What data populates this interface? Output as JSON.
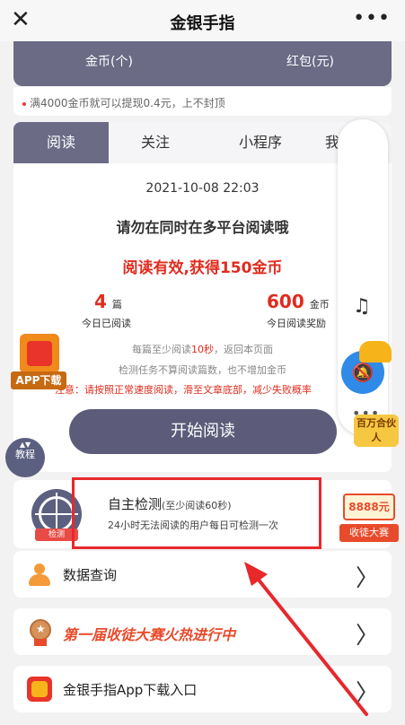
{
  "header": {
    "title": "金银手指",
    "close_glyph": "✕",
    "more_glyph": "•••"
  },
  "stats": {
    "gold_label": "金币(个)",
    "redpacket_label": "红包(元)"
  },
  "notice": "满4000金币就可以提现0.4元，上不封顶",
  "tabs": [
    {
      "label": "阅读",
      "active": true
    },
    {
      "label": "关注",
      "active": false
    },
    {
      "label": "小程序",
      "active": false
    },
    {
      "label": "我",
      "active": false
    }
  ],
  "reading": {
    "datetime": "2021-10-08 22:03",
    "warning": "请勿在同时在多平台阅读哦",
    "reward": "阅读有效,获得150金币",
    "read_count": "4",
    "read_unit": "篇",
    "read_label": "今日已阅读",
    "gold_count": "600",
    "gold_unit": "金币",
    "gold_label": "今日阅读奖励",
    "rule1_pre": "每篇至少阅读",
    "rule1_red": "10秒",
    "rule1_post": "，返回本页面",
    "rule2": "检测任务不算阅读篇数，也不增加金币",
    "rule3": "注意：请按照正常速度阅读，滑至文章底部，减少失败概率",
    "start_button": "开始阅读"
  },
  "floating": {
    "app_download": "APP下载",
    "partner": "百万合伙人",
    "tutorial": "教程",
    "tutorial_glyph": "▲▼",
    "music_glyph": "♫",
    "bell_glyph": "🔕",
    "dots_glyph": "•••",
    "prize_amount": "8888元",
    "prize_label": "收徒大赛"
  },
  "self_check": {
    "title": "自主检测",
    "subtitle": "(至少阅读60秒)",
    "desc": "24小时无法阅读的用户每日可检测一次",
    "badge": "检测"
  },
  "menu": [
    {
      "label": "数据查询"
    },
    {
      "label": "第一届收徒大赛火热进行中"
    },
    {
      "label": "金银手指App下载入口"
    }
  ],
  "chevron": "〉",
  "colors": {
    "accent": "#6b6b86",
    "red": "#e02b1e",
    "blue": "#2f8ae8",
    "highlight_box": "#e8282b"
  }
}
